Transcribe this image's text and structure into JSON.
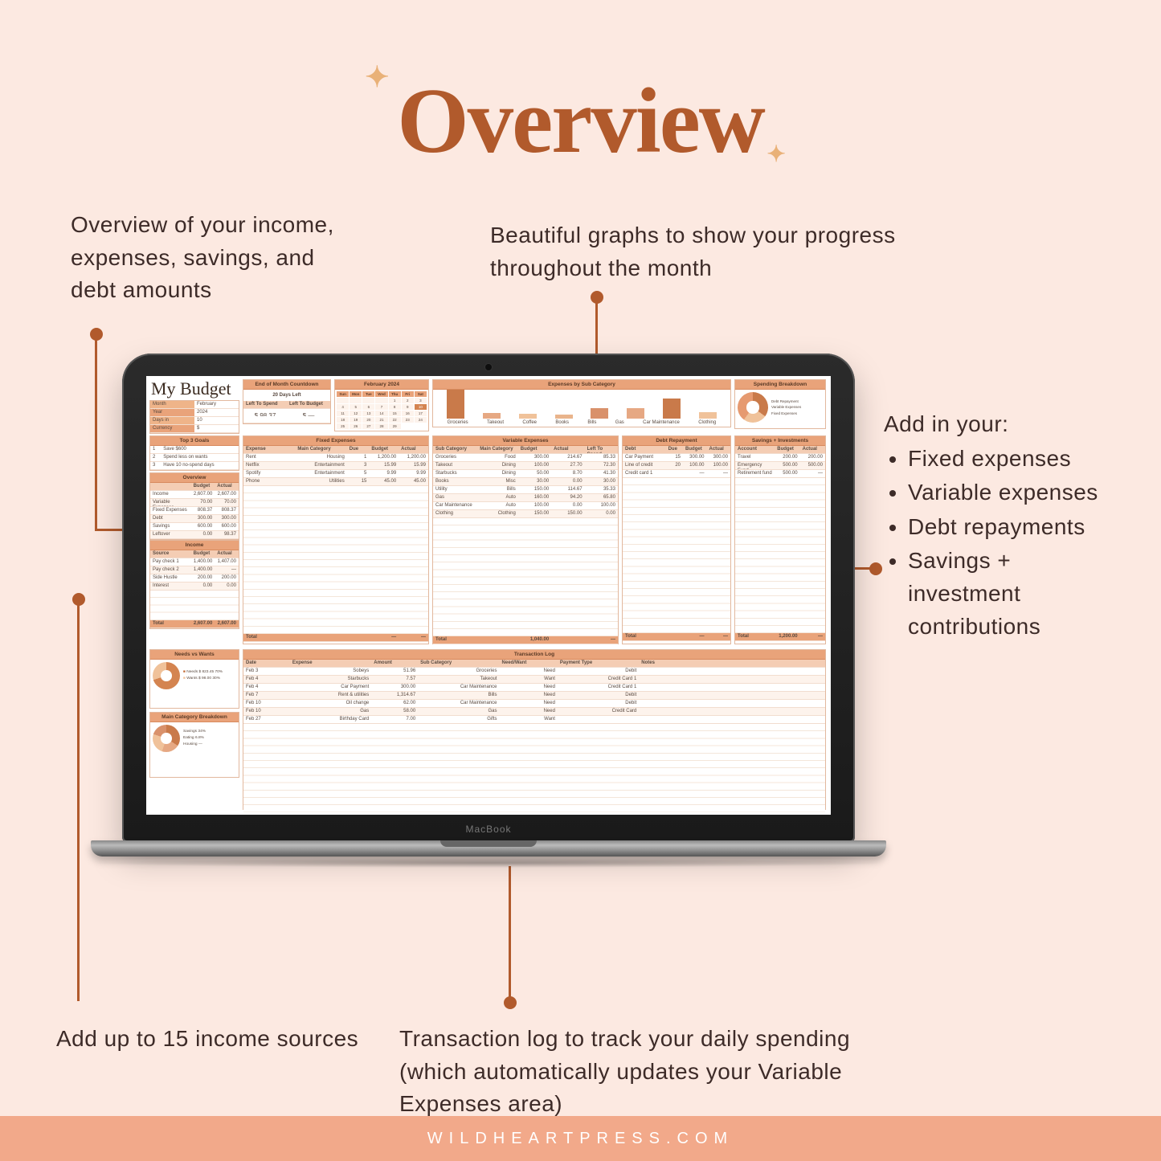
{
  "title": "Overview",
  "footer": "WILDHEARTPRESS.COM",
  "laptop_brand": "MacBook",
  "callouts": {
    "top_left": "Overview of your income, expenses, savings, and debt amounts",
    "top_right": "Beautiful graphs to show your progress throughout the month",
    "bot_left": "Add up to 15 income sources",
    "bot_mid": "Transaction log to track your daily spending (which automatically updates your Variable Expenses area)",
    "right_intro": "Add in your:",
    "right_items": [
      "Fixed expenses",
      "Variable expenses",
      "Debt repayments",
      "Savings + investment contributions"
    ]
  },
  "sheet": {
    "title": "My Budget",
    "month_box": {
      "Month": "February",
      "Year": "2024",
      "Days in": "10",
      "Currency": "$"
    },
    "countdown": {
      "header": "End of Month Countdown",
      "days_left": "20 Days Left",
      "left_to_spend_label": "Left To Spend",
      "left_to_spend": "$ 98.37",
      "left_to_budget_label": "Left To Budget",
      "left_to_budget": "$ —"
    },
    "calendar": {
      "header": "February 2024",
      "weekdays": [
        "Sun",
        "Mon",
        "Tue",
        "Wed",
        "Thu",
        "Fri",
        "Sat"
      ],
      "today": 10
    },
    "chart": {
      "header": "Expenses by Sub Category",
      "labels": [
        "Groceries",
        "Takeout",
        "Coffee",
        "Books",
        "Bills",
        "Gas",
        "Car Maintenance",
        "Clothing"
      ]
    },
    "chart_data": {
      "type": "bar",
      "categories": [
        "Groceries",
        "Takeout",
        "Coffee",
        "Books",
        "Bills",
        "Gas",
        "Car Maintenance",
        "Clothing"
      ],
      "values": [
        100,
        20,
        17,
        15,
        35,
        35,
        70,
        22
      ],
      "title": "Expenses by Sub Category",
      "xlabel": "",
      "ylabel": "",
      "ylim": [
        0,
        100
      ]
    },
    "spending_breakdown": {
      "header": "Spending Breakdown",
      "items": [
        "Debt Repayment",
        "Variable Expenses",
        "Fixed Expenses"
      ]
    },
    "goals": {
      "header": "Top 3 Goals",
      "items": [
        "Save $600",
        "Spend less on wants",
        "Have 10 no-spend days"
      ]
    },
    "overview": {
      "header": "Overview",
      "cols": [
        "",
        "Budget",
        "Actual"
      ],
      "rows": [
        [
          "Income",
          "2,607.00",
          "2,607.00"
        ],
        [
          "Variable Expenses",
          "70.00",
          "70.00"
        ],
        [
          "Fixed Expenses",
          "808.37",
          "808.37"
        ],
        [
          "Debt",
          "300.00",
          "300.00"
        ],
        [
          "Savings",
          "600.00",
          "600.00"
        ],
        [
          "Leftover",
          "0.00",
          "98.37"
        ]
      ]
    },
    "income": {
      "header": "Income",
      "cols": [
        "Source",
        "Budget",
        "Actual"
      ],
      "rows": [
        [
          "Pay check 1",
          "1,400.00",
          "1,407.00"
        ],
        [
          "Pay check 2",
          "1,400.00",
          "—"
        ],
        [
          "Side Hustle",
          "200.00",
          "200.00"
        ],
        [
          "Interest",
          "0.00",
          "0.00"
        ]
      ],
      "total": [
        "Total",
        "2,607.00",
        "2,607.00"
      ]
    },
    "fixed": {
      "header": "Fixed Expenses",
      "cols": [
        "Expense",
        "Main Category",
        "Due",
        "Budget",
        "Actual"
      ],
      "rows": [
        [
          "Rent",
          "Housing",
          "1",
          "1,200.00",
          "1,200.00"
        ],
        [
          "Netflix",
          "Entertainment",
          "3",
          "15.99",
          "15.99"
        ],
        [
          "Spotify",
          "Entertainment",
          "5",
          "9.99",
          "9.99"
        ],
        [
          "Phone",
          "Utilities",
          "15",
          "45.00",
          "45.00"
        ]
      ],
      "total": [
        "Total",
        "",
        "",
        "—",
        "—"
      ]
    },
    "variable": {
      "header": "Variable Expenses",
      "cols": [
        "Sub Category",
        "Main Category",
        "Budget",
        "Actual",
        "Left To Spend"
      ],
      "rows": [
        [
          "Groceries",
          "Food",
          "300.00",
          "214.67",
          "85.33"
        ],
        [
          "Takeout",
          "Dining",
          "100.00",
          "27.70",
          "72.30"
        ],
        [
          "Starbucks",
          "Dining",
          "50.00",
          "8.70",
          "41.30"
        ],
        [
          "Books",
          "Misc",
          "30.00",
          "0.00",
          "30.00"
        ],
        [
          "Utility",
          "Bills",
          "150.00",
          "114.67",
          "35.33"
        ],
        [
          "Gas",
          "Auto",
          "160.00",
          "94.20",
          "65.80"
        ],
        [
          "Car Maintenance",
          "Auto",
          "100.00",
          "0.00",
          "100.00"
        ],
        [
          "Clothing",
          "Clothing",
          "150.00",
          "150.00",
          "0.00"
        ]
      ],
      "total": [
        "Total",
        "",
        "1,040.00",
        "",
        "—"
      ]
    },
    "debt": {
      "header": "Debt Repayment",
      "cols": [
        "Debt",
        "Due",
        "Budget",
        "Actual"
      ],
      "rows": [
        [
          "Car Payment",
          "15",
          "300.00",
          "300.00"
        ],
        [
          "Line of credit",
          "20",
          "100.00",
          "100.00"
        ],
        [
          "Credit card 1",
          "",
          "—",
          "—"
        ]
      ],
      "total": [
        "Total",
        "",
        "—",
        "—"
      ]
    },
    "savings": {
      "header": "Savings + Investments",
      "cols": [
        "Account",
        "Budget",
        "Actual"
      ],
      "rows": [
        [
          "Travel",
          "200.00",
          "200.00"
        ],
        [
          "Emergency Fund",
          "500.00",
          "500.00"
        ],
        [
          "Retirement fund",
          "500.00",
          "—"
        ]
      ],
      "total": [
        "Total",
        "1,200.00",
        "—"
      ]
    },
    "needs_wants": {
      "header": "Needs vs Wants",
      "rows": [
        [
          "Needs",
          "823.45",
          "70%"
        ],
        [
          "Wants",
          "98.00",
          "30%"
        ]
      ]
    },
    "main_cat": {
      "header": "Main Category Breakdown",
      "rows": [
        [
          "Savings",
          "34%"
        ],
        [
          "Eating",
          "6.8%"
        ],
        [
          "Housing",
          "—"
        ]
      ]
    },
    "transactions": {
      "header": "Transaction Log",
      "cols": [
        "Date",
        "Expense",
        "Amount",
        "Sub Category",
        "Need/Want",
        "Payment Type",
        "Notes"
      ],
      "rows": [
        [
          "Feb 3",
          "Sobeys",
          "51.96",
          "Groceries",
          "Need",
          "Debit",
          ""
        ],
        [
          "Feb 4",
          "Starbucks",
          "7.57",
          "Takeout",
          "Want",
          "Credit Card 1",
          ""
        ],
        [
          "Feb 4",
          "Car Payment",
          "300.00",
          "Car Maintenance",
          "Need",
          "Credit Card 1",
          ""
        ],
        [
          "Feb 7",
          "Rent & utilities",
          "1,314.67",
          "Bills",
          "Need",
          "Debit",
          ""
        ],
        [
          "Feb 10",
          "Oil change",
          "62.00",
          "Car Maintenance",
          "Need",
          "Debit",
          ""
        ],
        [
          "Feb 10",
          "Gas",
          "58.00",
          "Gas",
          "Need",
          "Credit Card",
          ""
        ],
        [
          "Feb 27",
          "Birthday Card",
          "7.00",
          "Gifts",
          "Want",
          "",
          ""
        ]
      ]
    }
  }
}
